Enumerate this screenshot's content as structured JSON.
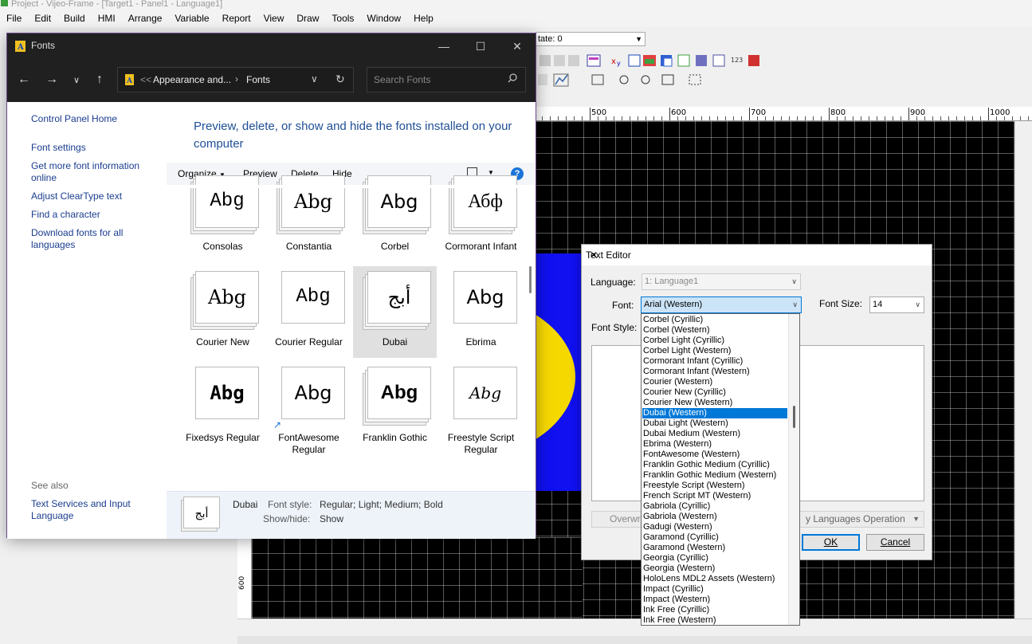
{
  "app": {
    "title": "Project - Vijeo-Frame - [Target1 - Panel1 - Language1]",
    "menu": [
      "File",
      "Edit",
      "Build",
      "HMI",
      "Arrange",
      "Variable",
      "Report",
      "View",
      "Draw",
      "Tools",
      "Window",
      "Help"
    ],
    "state_label": "tate: 0",
    "ruler_h_labels": [
      "500",
      "600",
      "700",
      "800",
      "900",
      "1000"
    ],
    "ruler_v_label": "600"
  },
  "fonts_window": {
    "title": "Fonts",
    "address": {
      "prefix": "<<",
      "crumb1": "Appearance and...",
      "crumb2": "Fonts"
    },
    "search_placeholder": "Search Fonts",
    "left_links": [
      "Control Panel Home",
      "Font settings",
      "Get more font information online",
      "Adjust ClearType text",
      "Find a character",
      "Download fonts for all languages"
    ],
    "see_also_label": "See also",
    "see_also_link": "Text Services and Input Language",
    "heading": "Preview, delete, or show and hide the fonts installed on your computer",
    "commands": {
      "organize": "Organize",
      "preview": "Preview",
      "delete": "Delete",
      "hide": "Hide"
    },
    "tiles": [
      {
        "name": "Consolas",
        "sample": "Abg"
      },
      {
        "name": "Constantia",
        "sample": "Abg"
      },
      {
        "name": "Corbel",
        "sample": "Abg"
      },
      {
        "name": "Cormorant Infant",
        "sample": "Абф"
      },
      {
        "name": "Courier New",
        "sample": "Abg"
      },
      {
        "name": "Courier Regular",
        "sample": "Abg"
      },
      {
        "name": "Dubai",
        "sample": "أبج"
      },
      {
        "name": "Ebrima",
        "sample": "Abg"
      },
      {
        "name": "Fixedsys Regular",
        "sample": "Abg"
      },
      {
        "name": "FontAwesome Regular",
        "sample": "Abg"
      },
      {
        "name": "Franklin Gothic",
        "sample": "Abg"
      },
      {
        "name": "Freestyle Script Regular",
        "sample": "Abg"
      }
    ],
    "details": {
      "sample": "أبج",
      "name": "Dubai",
      "style_label": "Font style:",
      "style_value": "Regular; Light; Medium; Bold",
      "show_label": "Show/hide:",
      "show_value": "Show"
    }
  },
  "text_editor": {
    "title": "Text Editor",
    "language_label": "Language:",
    "language_value": "1: Language1",
    "font_label": "Font:",
    "font_value": "Arial (Western)",
    "font_size_label": "Font Size:",
    "font_size_value": "14",
    "font_style_label": "Font Style:",
    "overwrite_label": "Overwrit",
    "languages_op_label": "y Languages Operation",
    "ok_label": "OK",
    "cancel_label": "Cancel",
    "dropdown_items": [
      "Corbel (Cyrillic)",
      "Corbel (Western)",
      "Corbel Light (Cyrillic)",
      "Corbel Light (Western)",
      "Cormorant Infant (Cyrillic)",
      "Cormorant Infant (Western)",
      "Courier (Western)",
      "Courier New (Cyrillic)",
      "Courier New (Western)",
      "Dubai (Western)",
      "Dubai Light (Western)",
      "Dubai Medium (Western)",
      "Ebrima (Western)",
      "FontAwesome (Western)",
      "Franklin Gothic Medium (Cyrillic)",
      "Franklin Gothic Medium (Western)",
      "Freestyle Script (Western)",
      "French Script MT (Western)",
      "Gabriola (Cyrillic)",
      "Gabriola (Western)",
      "Gadugi (Western)",
      "Garamond (Cyrillic)",
      "Garamond (Western)",
      "Georgia (Cyrillic)",
      "Georgia (Western)",
      "HoloLens MDL2 Assets (Western)",
      "Impact (Cyrillic)",
      "Impact (Western)",
      "Ink Free (Cyrillic)",
      "Ink Free (Western)"
    ],
    "dropdown_selected_index": 9
  }
}
